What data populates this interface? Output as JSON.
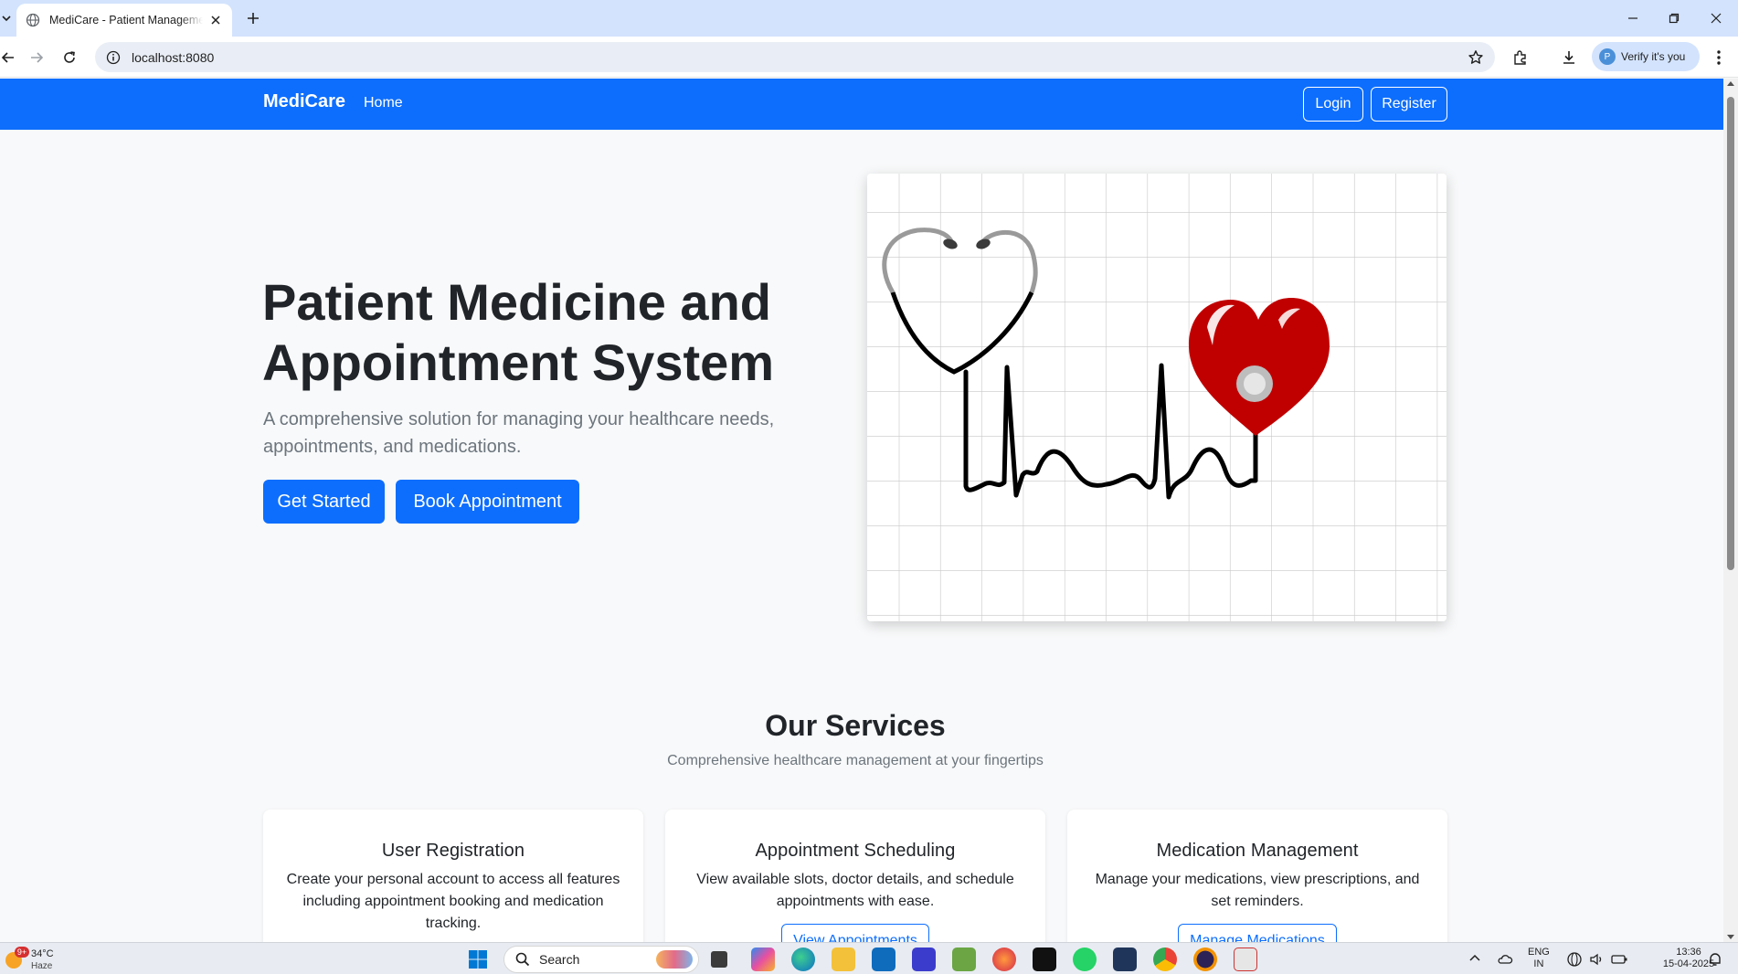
{
  "browser": {
    "tab_title": "MediCare - Patient Management",
    "url": "localhost:8080",
    "verify_label": "Verify it's you"
  },
  "nav": {
    "brand": "MediCare",
    "home": "Home",
    "login": "Login",
    "register": "Register"
  },
  "hero": {
    "title_line1": "Patient Medicine and",
    "title_line2": "Appointment System",
    "subtitle_line1": "A comprehensive solution for managing your healthcare needs,",
    "subtitle_line2": "appointments, and medications.",
    "get_started": "Get Started",
    "book_appointment": "Book Appointment"
  },
  "services": {
    "title": "Our Services",
    "subtitle": "Comprehensive healthcare management at your fingertips",
    "cards": [
      {
        "title": "User Registration",
        "text": "Create your personal account to access all features including appointment booking and medication tracking.",
        "button": ""
      },
      {
        "title": "Appointment Scheduling",
        "text": "View available slots, doctor details, and schedule appointments with ease.",
        "button": "View Appointments"
      },
      {
        "title": "Medication Management",
        "text": "Manage your medications, view prescriptions, and set reminders.",
        "button": "Manage Medications"
      }
    ]
  },
  "taskbar": {
    "weather_badge": "9+",
    "temperature": "34°C",
    "condition": "Haze",
    "search": "Search",
    "lang_line1": "ENG",
    "lang_line2": "IN",
    "time": "13:36",
    "date": "15-04-2025"
  },
  "colors": {
    "primary": "#0d6efd",
    "page_bg": "#f8f9fa",
    "heart": "#c00000"
  }
}
